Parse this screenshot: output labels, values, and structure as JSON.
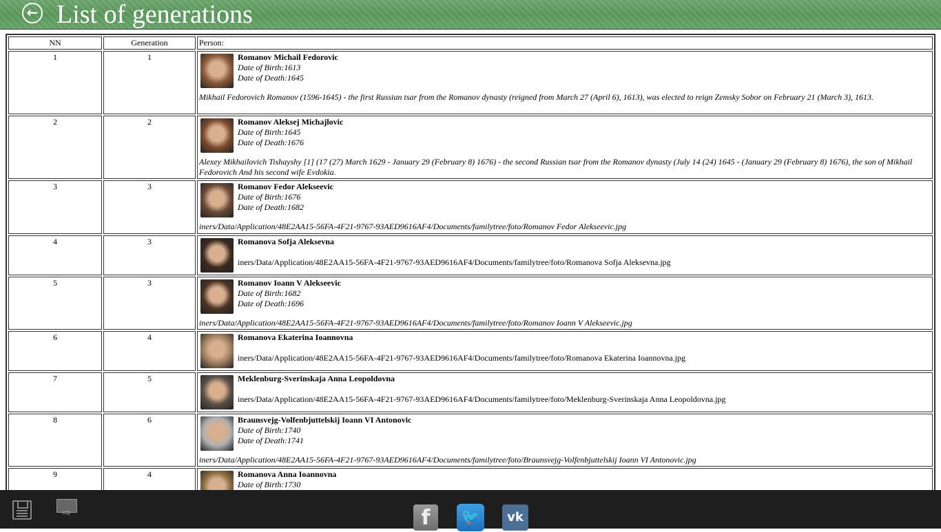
{
  "header": {
    "title": "List of generations",
    "back_icon": "back-arrow-circle-icon"
  },
  "table": {
    "columns": [
      "NN",
      "Generation",
      "Person:"
    ],
    "rows": [
      {
        "nn": "1",
        "gen": "1",
        "name": "Romanov Michail Fedorovic",
        "birth": "Date of Birth:1613",
        "death": "Date of Death:1645",
        "desc": "Mikhail Fedorovich Romanov (1596-1645) - the first Russian tsar from the Romanov dynasty (reigned from March 27 (April 6), 1613), was elected to reign Zemsky Sobor on February 21 (March 3), 1613.",
        "italic": true,
        "photo": "#8a5a3a"
      },
      {
        "nn": "2",
        "gen": "2",
        "name": "Romanov Aleksej Michajlovic",
        "birth": "Date of Birth:1645",
        "death": "Date of Death:1676",
        "desc": "Alexey Mikhailovich Tishayshy [1] (17 (27) March 1629 - January 29 (February 8) 1676) - the second Russian tsar from the Romanov dynasty (July 14 (24) 1645 - (January 29 (February 8) 1676), the son of Mikhail Fedorovich And his second wife Evdokia.",
        "italic": true,
        "photo": "#7a4a30"
      },
      {
        "nn": "3",
        "gen": "3",
        "name": "Romanov Fedor Alekseevic",
        "birth": "Date of Birth:1676",
        "death": "Date of Death:1682",
        "desc": "iners/Data/Application/48E2AA15-56FA-4F21-9767-93AED9616AF4/Documents/familytree/foto/Romanov Fedor Alekseevic.jpg",
        "italic": true,
        "photo": "#6a4a38"
      },
      {
        "nn": "4",
        "gen": "3",
        "name": "Romanova Sofja Aleksevna",
        "birth": "",
        "death": "",
        "desc": "iners/Data/Application/48E2AA15-56FA-4F21-9767-93AED9616AF4/Documents/familytree/foto/Romanova Sofja Aleksevna.jpg",
        "italic": false,
        "photo": "#3a2a20"
      },
      {
        "nn": "5",
        "gen": "3",
        "name": "Romanov Ioann V Alekseevic",
        "birth": "Date of Birth:1682",
        "death": "Date of Death:1696",
        "desc": "iners/Data/Application/48E2AA15-56FA-4F21-9767-93AED9616AF4/Documents/familytree/foto/Romanov Ioann V Alekseevic.jpg",
        "italic": true,
        "photo": "#4a3424"
      },
      {
        "nn": "6",
        "gen": "4",
        "name": "Romanova Ekaterina Ioannovna",
        "birth": "",
        "death": "",
        "desc": "iners/Data/Application/48E2AA15-56FA-4F21-9767-93AED9616AF4/Documents/familytree/foto/Romanova Ekaterina Ioannovna.jpg",
        "italic": false,
        "photo": "#a08060"
      },
      {
        "nn": "7",
        "gen": "5",
        "name": "Meklenburg-Sverinskaja Anna Leopoldovna",
        "birth": "",
        "death": "",
        "desc": "iners/Data/Application/48E2AA15-56FA-4F21-9767-93AED9616AF4/Documents/familytree/foto/Meklenburg-Sverinskaja Anna Leopoldovna.jpg",
        "italic": false,
        "photo": "#5a5048"
      },
      {
        "nn": "8",
        "gen": "6",
        "name": "Braunsvejg-Volfenbjuttelskij Ioann VI Antonovic",
        "birth": "Date of Birth:1740",
        "death": "Date of Death:1741",
        "desc": "iners/Data/Application/48E2AA15-56FA-4F21-9767-93AED9616AF4/Documents/familytree/foto/Braunsvejg-Volfenbjuttelskij Ioann VI Antonovic.jpg",
        "italic": true,
        "photo": "#b0b0b0"
      },
      {
        "nn": "9",
        "gen": "4",
        "name": "Romanova Anna Ioannovna",
        "birth": "Date of Birth:1730",
        "death": "",
        "desc": "",
        "italic": true,
        "photo": "#8a6a40"
      }
    ]
  },
  "toolbar": {
    "save_icon": "floppy-disk-icon",
    "export_icon": "export-icon",
    "facebook": "f",
    "twitter": "twitter-bird-icon",
    "vk": "vk"
  }
}
